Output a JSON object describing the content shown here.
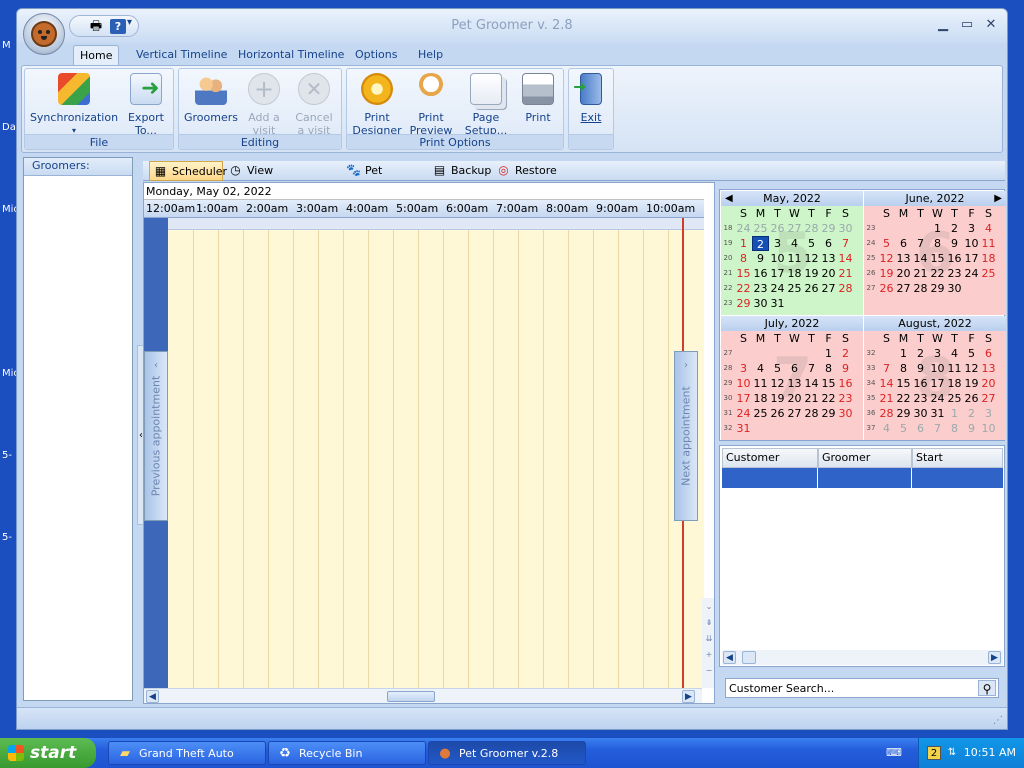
{
  "desktop": {
    "fragments": [
      "M",
      "Da",
      "Mic",
      "Mic",
      "5-",
      "5-"
    ]
  },
  "window": {
    "title": "Pet Groomer v. 2.8",
    "qat_more": "▾",
    "controls": {
      "minimize": "▁",
      "maximize": "▭",
      "close": "✕"
    }
  },
  "ribbon": {
    "tabs": [
      "Home",
      "Vertical Timeline",
      "Horizontal Timeline",
      "Options",
      "Help"
    ],
    "active_tab": "Home",
    "groups": {
      "file": {
        "label": "File",
        "sync": "Synchronization",
        "export_1": "Export",
        "export_2": "To..."
      },
      "editing": {
        "label": "Editing",
        "groomers": "Groomers",
        "add_1": "Add a",
        "add_2": "visit",
        "cancel_1": "Cancel",
        "cancel_2": "a visit"
      },
      "print": {
        "label": "Print Options",
        "designer_1": "Print",
        "designer_2": "Designer",
        "preview_1": "Print",
        "preview_2": "Preview",
        "setup_1": "Page",
        "setup_2": "Setup...",
        "print": "Print"
      },
      "exit": {
        "label": "",
        "exit": "Exit"
      }
    }
  },
  "groomers_panel": {
    "header": "Groomers:"
  },
  "content_tabs": [
    "Scheduler",
    "View Reservations",
    "Pet Owners",
    "Backup",
    "Restore"
  ],
  "scheduler": {
    "date": "Monday, May 02, 2022",
    "times": [
      "12:00am",
      "1:00am",
      "2:00am",
      "3:00am",
      "4:00am",
      "5:00am",
      "6:00am",
      "7:00am",
      "8:00am",
      "9:00am",
      "10:00am"
    ],
    "prev_label": "Previous appointment",
    "next_label": "Next appointment"
  },
  "calendars": {
    "dow": [
      "S",
      "M",
      "T",
      "W",
      "T",
      "F",
      "S"
    ],
    "months": [
      {
        "title": "May, 2022",
        "big": "5",
        "weeks": [
          {
            "wk": "18",
            "days": [
              "24",
              "25",
              "26",
              "27",
              "28",
              "29",
              "30"
            ]
          },
          {
            "wk": "19",
            "days": [
              "1",
              "2",
              "3",
              "4",
              "5",
              "6",
              "7"
            ]
          },
          {
            "wk": "20",
            "days": [
              "8",
              "9",
              "10",
              "11",
              "12",
              "13",
              "14"
            ]
          },
          {
            "wk": "21",
            "days": [
              "15",
              "16",
              "17",
              "18",
              "19",
              "20",
              "21"
            ]
          },
          {
            "wk": "22",
            "days": [
              "22",
              "23",
              "24",
              "25",
              "26",
              "27",
              "28"
            ]
          },
          {
            "wk": "23",
            "days": [
              "29",
              "30",
              "31",
              "",
              "",
              "",
              ""
            ]
          }
        ]
      },
      {
        "title": "June, 2022",
        "big": "6",
        "weeks": [
          {
            "wk": "23",
            "days": [
              "",
              "",
              "",
              "1",
              "2",
              "3",
              "4"
            ]
          },
          {
            "wk": "24",
            "days": [
              "5",
              "6",
              "7",
              "8",
              "9",
              "10",
              "11"
            ]
          },
          {
            "wk": "25",
            "days": [
              "12",
              "13",
              "14",
              "15",
              "16",
              "17",
              "18"
            ]
          },
          {
            "wk": "26",
            "days": [
              "19",
              "20",
              "21",
              "22",
              "23",
              "24",
              "25"
            ]
          },
          {
            "wk": "27",
            "days": [
              "26",
              "27",
              "28",
              "29",
              "30",
              "",
              ""
            ]
          },
          {
            "wk": "",
            "days": [
              "",
              "",
              "",
              "",
              "",
              "",
              ""
            ]
          }
        ]
      },
      {
        "title": "July, 2022",
        "big": "7",
        "weeks": [
          {
            "wk": "27",
            "days": [
              "",
              "",
              "",
              "",
              "",
              "1",
              "2"
            ]
          },
          {
            "wk": "28",
            "days": [
              "3",
              "4",
              "5",
              "6",
              "7",
              "8",
              "9"
            ]
          },
          {
            "wk": "29",
            "days": [
              "10",
              "11",
              "12",
              "13",
              "14",
              "15",
              "16"
            ]
          },
          {
            "wk": "30",
            "days": [
              "17",
              "18",
              "19",
              "20",
              "21",
              "22",
              "23"
            ]
          },
          {
            "wk": "31",
            "days": [
              "24",
              "25",
              "26",
              "27",
              "28",
              "29",
              "30"
            ]
          },
          {
            "wk": "32",
            "days": [
              "31",
              "",
              "",
              "",
              "",
              "",
              ""
            ]
          }
        ]
      },
      {
        "title": "August, 2022",
        "big": "8",
        "weeks": [
          {
            "wk": "32",
            "days": [
              "",
              "1",
              "2",
              "3",
              "4",
              "5",
              "6"
            ]
          },
          {
            "wk": "33",
            "days": [
              "7",
              "8",
              "9",
              "10",
              "11",
              "12",
              "13"
            ]
          },
          {
            "wk": "34",
            "days": [
              "14",
              "15",
              "16",
              "17",
              "18",
              "19",
              "20"
            ]
          },
          {
            "wk": "35",
            "days": [
              "21",
              "22",
              "23",
              "24",
              "25",
              "26",
              "27"
            ]
          },
          {
            "wk": "36",
            "days": [
              "28",
              "29",
              "30",
              "31",
              "1",
              "2",
              "3"
            ]
          },
          {
            "wk": "37",
            "days": [
              "4",
              "5",
              "6",
              "7",
              "8",
              "9",
              "10"
            ]
          }
        ]
      }
    ],
    "selected": "2"
  },
  "appointments": {
    "columns": [
      "Customer",
      "Groomer",
      "Start"
    ]
  },
  "search": {
    "placeholder": "Customer Search..."
  },
  "taskbar": {
    "start": "start",
    "tasks": [
      "Grand Theft Auto",
      "Recycle Bin",
      "Pet Groomer v.2.8"
    ],
    "tray_badge": "2",
    "clock": "10:51 AM"
  }
}
